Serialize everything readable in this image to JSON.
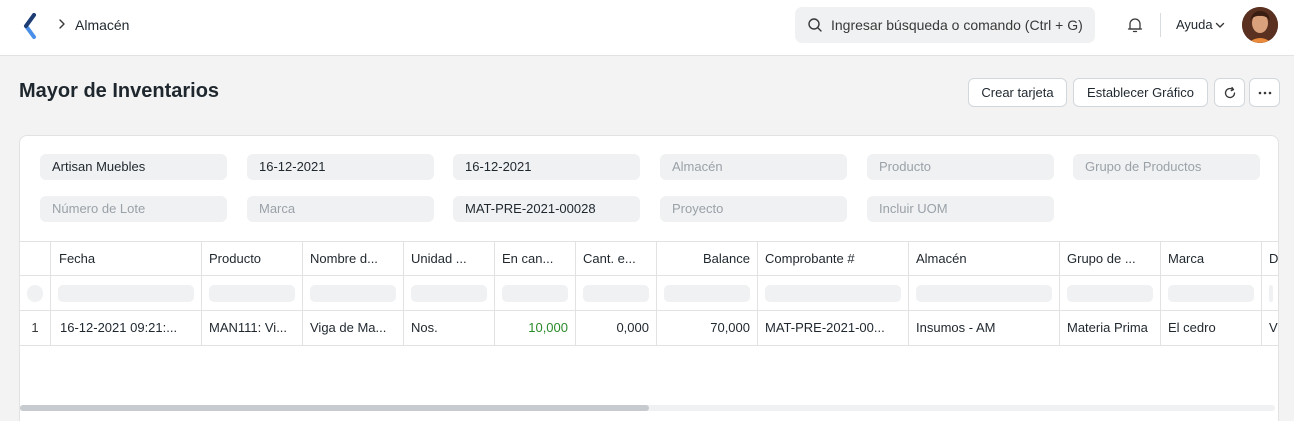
{
  "navbar": {
    "breadcrumb": "Almacén",
    "search_placeholder": "Ingresar búsqueda o comando (Ctrl + G)",
    "help_label": "Ayuda"
  },
  "page": {
    "title": "Mayor de Inventarios",
    "buttons": {
      "create_card": "Crear tarjeta",
      "set_chart": "Establecer Gráfico"
    }
  },
  "filters": {
    "company": "Artisan Muebles",
    "from_date": "16-12-2021",
    "to_date": "16-12-2021",
    "warehouse_placeholder": "Almacén",
    "product_placeholder": "Producto",
    "product_group_placeholder": "Grupo de Productos",
    "batch_placeholder": "Número de Lote",
    "brand_placeholder": "Marca",
    "voucher_no": "MAT-PRE-2021-00028",
    "project_placeholder": "Proyecto",
    "include_uom_placeholder": "Incluir UOM"
  },
  "table": {
    "columns": [
      "Fecha",
      "Producto",
      "Nombre d...",
      "Unidad ...",
      "En can...",
      "Cant. e...",
      "Balance",
      "Comprobante #",
      "Almacén",
      "Grupo de ...",
      "Marca",
      "D"
    ],
    "rows": [
      {
        "num": "1",
        "cells": [
          "16-12-2021 09:21:...",
          "MAN111: Vi...",
          "Viga de Ma...",
          "Nos.",
          "10,000",
          "0,000",
          "70,000",
          "MAT-PRE-2021-00...",
          "Insumos - AM",
          "Materia Prima",
          "El cedro",
          "V"
        ]
      }
    ]
  },
  "colors": {
    "positive_qty": "#2b8a2b",
    "field_bg": "#f0f1f2",
    "border": "#e2e2e2"
  },
  "icons": [
    "back-logo-icon",
    "chevron-right-icon",
    "search-icon",
    "bell-icon",
    "chevron-down-icon",
    "refresh-icon",
    "more-icon"
  ]
}
